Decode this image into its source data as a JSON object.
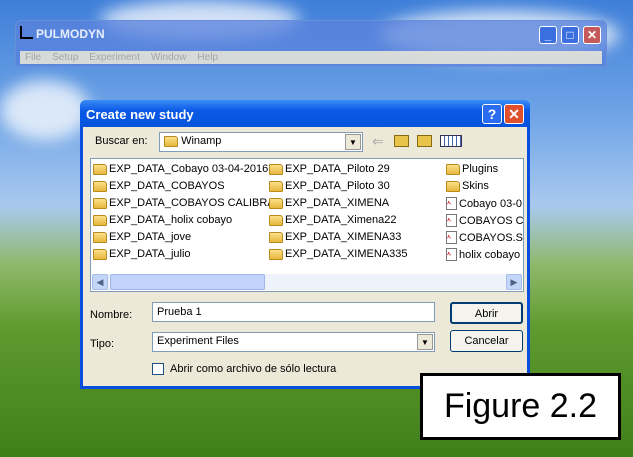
{
  "main_window": {
    "title": "PULMODYN",
    "menu": [
      "File",
      "Setup",
      "Experiment",
      "Window",
      "Help"
    ],
    "controls": {
      "minimize": "_",
      "maximize": "□",
      "close": "✕"
    }
  },
  "dialog": {
    "title": "Create new study",
    "help": "?",
    "close": "✕",
    "look_in_label": "Buscar en:",
    "look_in_value": "Winamp",
    "files": [
      {
        "name": "EXP_DATA_Cobayo 03-04-2016",
        "type": "folder"
      },
      {
        "name": "EXP_DATA_COBAYOS",
        "type": "folder"
      },
      {
        "name": "EXP_DATA_COBAYOS CALIBRA",
        "type": "folder"
      },
      {
        "name": "EXP_DATA_holix  cobayo",
        "type": "folder"
      },
      {
        "name": "EXP_DATA_jove",
        "type": "folder"
      },
      {
        "name": "EXP_DATA_julio",
        "type": "folder"
      },
      {
        "name": "EXP_DATA_Piloto 29",
        "type": "folder"
      },
      {
        "name": "EXP_DATA_Piloto 30",
        "type": "folder"
      },
      {
        "name": "EXP_DATA_XIMENA",
        "type": "folder"
      },
      {
        "name": "EXP_DATA_Ximena22",
        "type": "folder"
      },
      {
        "name": "EXP_DATA_XIMENA33",
        "type": "folder"
      },
      {
        "name": "EXP_DATA_XIMENA335",
        "type": "folder"
      },
      {
        "name": "Plugins",
        "type": "folder"
      },
      {
        "name": "Skins",
        "type": "folder"
      },
      {
        "name": "Cobayo 03-0",
        "type": "file"
      },
      {
        "name": "COBAYOS CA",
        "type": "file"
      },
      {
        "name": "COBAYOS.ST",
        "type": "file"
      },
      {
        "name": "holix  cobayo",
        "type": "file"
      }
    ],
    "name_label": "Nombre:",
    "name_value": "Prueba 1",
    "type_label": "Tipo:",
    "type_value": "Experiment Files",
    "open_button": "Abrir",
    "cancel_button": "Cancelar",
    "readonly_label": "Abrir como archivo de sólo lectura",
    "readonly_checked": false
  },
  "figure_label": "Figure 2.2"
}
